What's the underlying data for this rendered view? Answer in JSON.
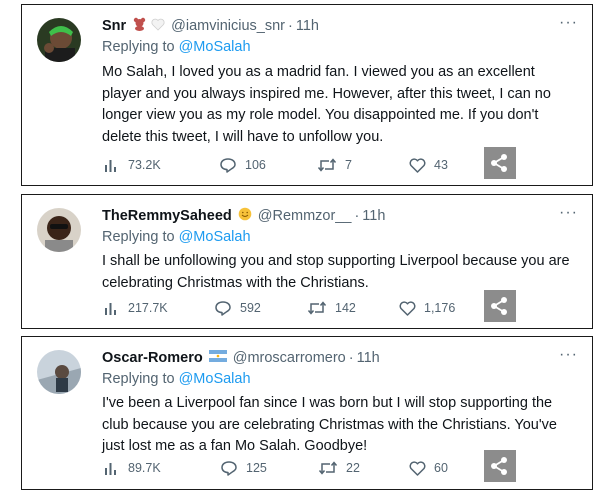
{
  "tweets": [
    {
      "name": "Snr",
      "badges": [
        "teddy-bear-emoji",
        "white-heart-emoji"
      ],
      "handle": "@iamvinicius_snr",
      "dot": "·",
      "time": "11h",
      "reply_prefix": "Replying to",
      "reply_to": "@MoSalah",
      "text": "Mo Salah, I loved you as a madrid fan. I viewed you as an excellent player and you always inspired me. However, after this tweet, I can no longer view you as my role model. You disappointed me. If you don't delete this tweet, I will have to unfollow you.",
      "views": "73.2K",
      "replies": "106",
      "retweets": "7",
      "likes": "43",
      "more": "···"
    },
    {
      "name": "TheRemmySaheed",
      "badges": [
        "smiling-face-emoji"
      ],
      "handle": "@Remmzor__",
      "dot": "·",
      "time": "11h",
      "reply_prefix": "Replying to",
      "reply_to": "@MoSalah",
      "text": "I shall be unfollowing you and stop supporting Liverpool because you are celebrating Christmas with the Christians.",
      "views": "217.7K",
      "replies": "592",
      "retweets": "142",
      "likes": "1,176",
      "more": "···"
    },
    {
      "name": "Oscar-Romero",
      "badges": [
        "argentina-flag-emoji"
      ],
      "handle": "@mroscarromero",
      "dot": "·",
      "time": "11h",
      "reply_prefix": "Replying to",
      "reply_to": "@MoSalah",
      "text": "I've been a Liverpool fan since I was born but I will stop supporting the club because you are celebrating Christmas with the Christians. You've just lost me as a fan Mo Salah. Goodbye!",
      "views": "89.7K",
      "replies": "125",
      "retweets": "22",
      "likes": "60",
      "more": "···"
    }
  ],
  "colors": {
    "link": "#1d9bf0",
    "secondary": "#536471",
    "text": "#0f1419",
    "share_bg": "#8c8c8c"
  }
}
